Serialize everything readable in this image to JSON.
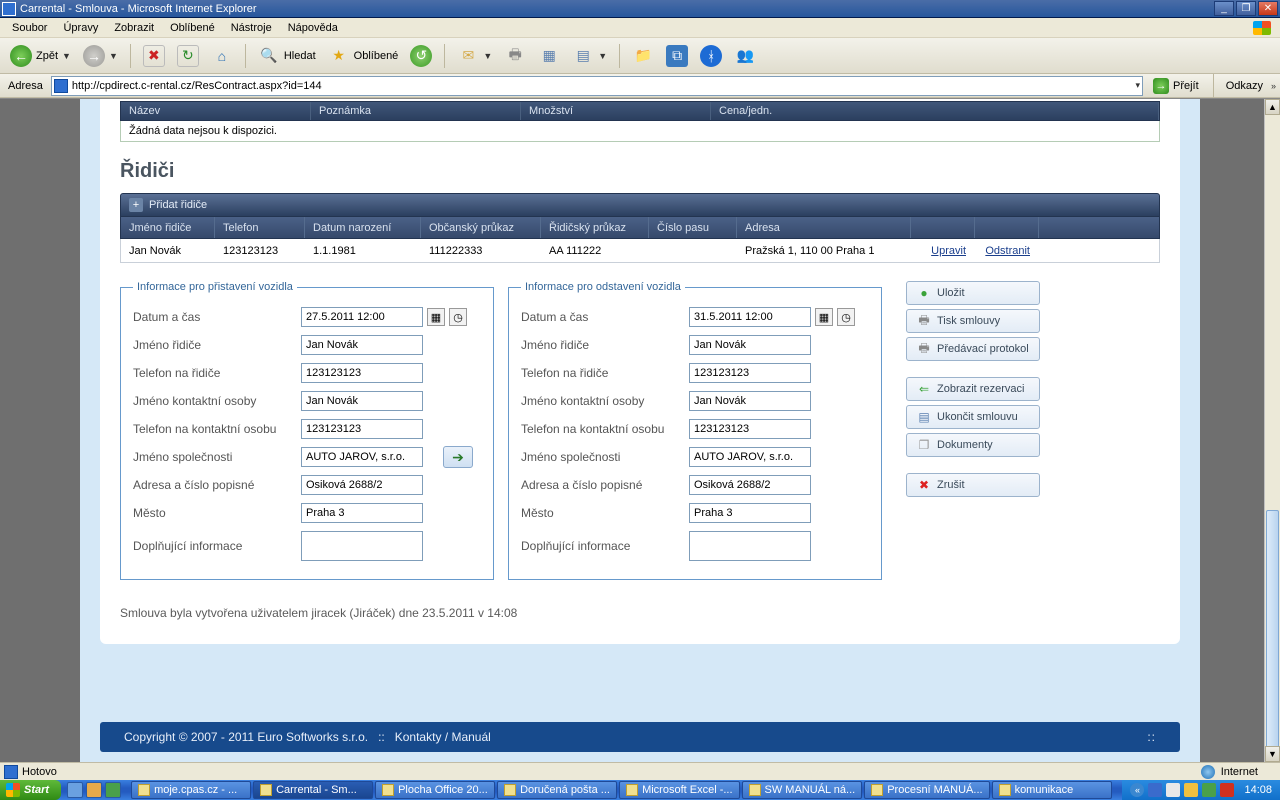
{
  "window": {
    "title": "Carrental - Smlouva - Microsoft Internet Explorer"
  },
  "menu": {
    "items": [
      "Soubor",
      "Úpravy",
      "Zobrazit",
      "Oblíbené",
      "Nástroje",
      "Nápověda"
    ]
  },
  "toolbar": {
    "back": "Zpět",
    "search": "Hledat",
    "favorites": "Oblíbené"
  },
  "address": {
    "label": "Adresa",
    "url": "http://cpdirect.c-rental.cz/ResContract.aspx?id=144",
    "go": "Přejít",
    "links": "Odkazy"
  },
  "top_table": {
    "cols": [
      "Název",
      "Poznámka",
      "Množství",
      "Cena/jedn."
    ],
    "empty": "Žádná data nejsou k dispozici."
  },
  "section_drivers": "Řidiči",
  "drivers": {
    "add": "Přidat řidiče",
    "cols": [
      "Jméno řidiče",
      "Telefon",
      "Datum narození",
      "Občanský průkaz",
      "Řidičský průkaz",
      "Číslo pasu",
      "Adresa"
    ],
    "row": {
      "name": "Jan Novák",
      "phone": "123123123",
      "dob": "1.1.1981",
      "id": "111222333",
      "licence": "AA 111222",
      "passport": "",
      "address": "Pražská 1, 110 00 Praha 1"
    },
    "edit": "Upravit",
    "delete": "Odstranit"
  },
  "pickup": {
    "legend": "Informace pro přistavení vozidla",
    "labels": {
      "datetime": "Datum a čas",
      "driver": "Jméno řidiče",
      "driver_phone": "Telefon na řidiče",
      "contact": "Jméno kontaktní osoby",
      "contact_phone": "Telefon na kontaktní osobu",
      "company": "Jméno společnosti",
      "address": "Adresa a číslo popisné",
      "city": "Město",
      "extra": "Doplňující informace"
    },
    "values": {
      "datetime": "27.5.2011 12:00",
      "driver": "Jan Novák",
      "driver_phone": "123123123",
      "contact": "Jan Novák",
      "contact_phone": "123123123",
      "company": "AUTO JAROV, s.r.o.",
      "address": "Osiková 2688/2",
      "city": "Praha 3",
      "extra": ""
    }
  },
  "dropoff": {
    "legend": "Informace pro odstavení vozidla",
    "values": {
      "datetime": "31.5.2011 12:00",
      "driver": "Jan Novák",
      "driver_phone": "123123123",
      "contact": "Jan Novák",
      "contact_phone": "123123123",
      "company": "AUTO JAROV, s.r.o.",
      "address": "Osiková 2688/2",
      "city": "Praha 3",
      "extra": ""
    }
  },
  "actions": {
    "save": "Uložit",
    "print": "Tisk smlouvy",
    "protocol": "Předávací protokol",
    "show_res": "Zobrazit rezervaci",
    "end": "Ukončit smlouvu",
    "docs": "Dokumenty",
    "cancel": "Zrušit"
  },
  "created_note": "Smlouva byla vytvořena uživatelem jiracek (Jiráček) dne 23.5.2011 v 14:08",
  "footer": {
    "copyright": "Copyright © 2007 - 2011 Euro Softworks s.r.o.",
    "links": "Kontakty / Manuál"
  },
  "status": {
    "left": "Hotovo",
    "zone": "Internet"
  },
  "taskbar": {
    "start": "Start",
    "tasks": [
      "moje.cpas.cz - ...",
      "Carrental - Sm...",
      "Plocha Office 20...",
      "Doručená pošta ...",
      "Microsoft Excel -...",
      "SW MANUÁL ná...",
      "Procesní MANUÁ...",
      "komunikace"
    ],
    "active_index": 1,
    "clock": "14:08"
  }
}
